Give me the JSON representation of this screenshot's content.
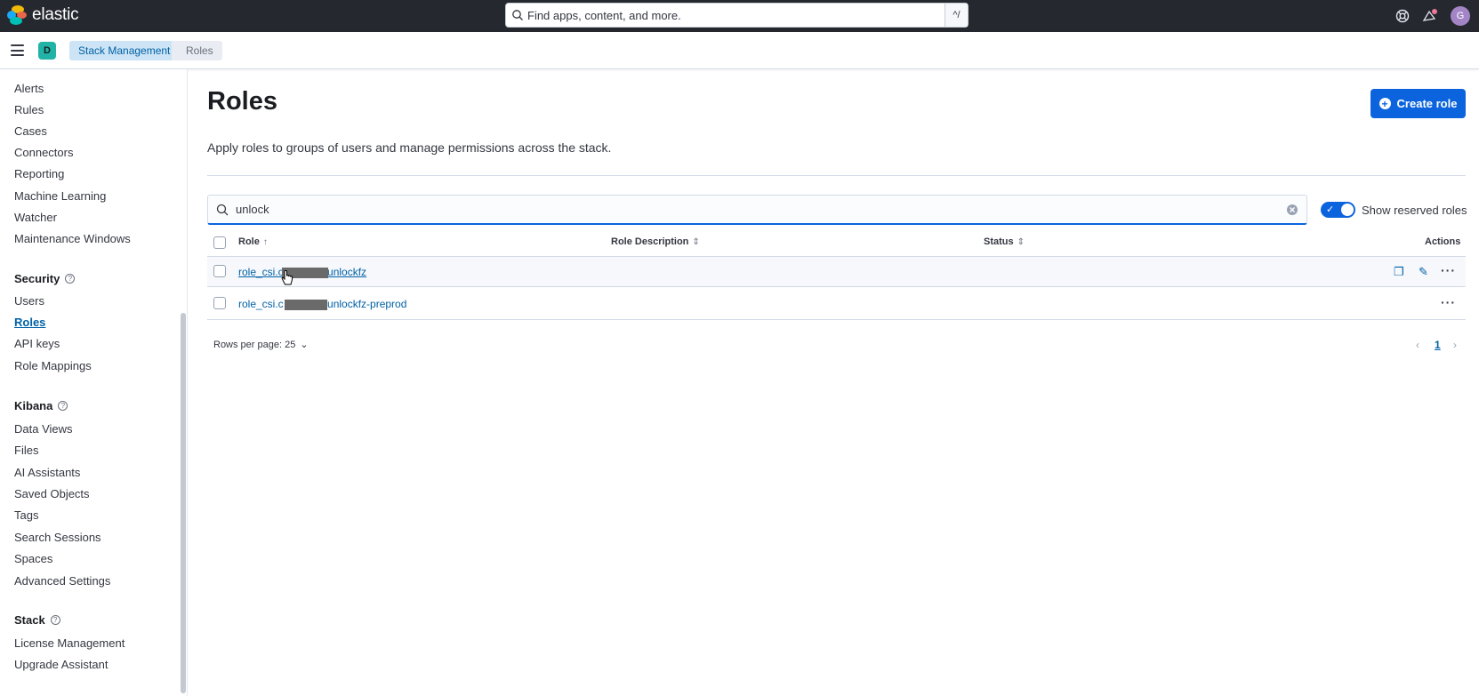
{
  "header": {
    "brand": "elastic",
    "search_placeholder": "Find apps, content, and more.",
    "search_shortcut": "^/",
    "avatar_initial": "G",
    "brand_colors": [
      "#f0b90b",
      "#1ba9f5",
      "#e7664c",
      "#00bfb3",
      "#0077cc"
    ]
  },
  "subheader": {
    "space_initial": "D",
    "breadcrumbs": [
      "Stack Management",
      "Roles"
    ]
  },
  "sidebar": {
    "group1_items": [
      "Alerts",
      "Rules",
      "Cases",
      "Connectors",
      "Reporting",
      "Machine Learning",
      "Watcher",
      "Maintenance Windows"
    ],
    "security_title": "Security",
    "security_items": [
      "Users",
      "Roles",
      "API keys",
      "Role Mappings"
    ],
    "kibana_title": "Kibana",
    "kibana_items": [
      "Data Views",
      "Files",
      "AI Assistants",
      "Saved Objects",
      "Tags",
      "Search Sessions",
      "Spaces",
      "Advanced Settings"
    ],
    "stack_title": "Stack",
    "stack_items": [
      "License Management",
      "Upgrade Assistant"
    ],
    "active_item": "Roles"
  },
  "main": {
    "title": "Roles",
    "description": "Apply roles to groups of users and manage permissions across the stack.",
    "create_button": "Create role",
    "filter_value": "unlock",
    "toggle_label": "Show reserved roles",
    "toggle_on": true,
    "columns": {
      "role": "Role",
      "description": "Role Description",
      "status": "Status",
      "actions": "Actions"
    },
    "rows": [
      {
        "prefix": "role_csi.c",
        "suffix": ".unlockfz"
      },
      {
        "prefix": "role_csi.c",
        "suffix": ".unlockfz-preprod"
      }
    ],
    "rows_per_page": "Rows per page: 25",
    "current_page": "1"
  }
}
